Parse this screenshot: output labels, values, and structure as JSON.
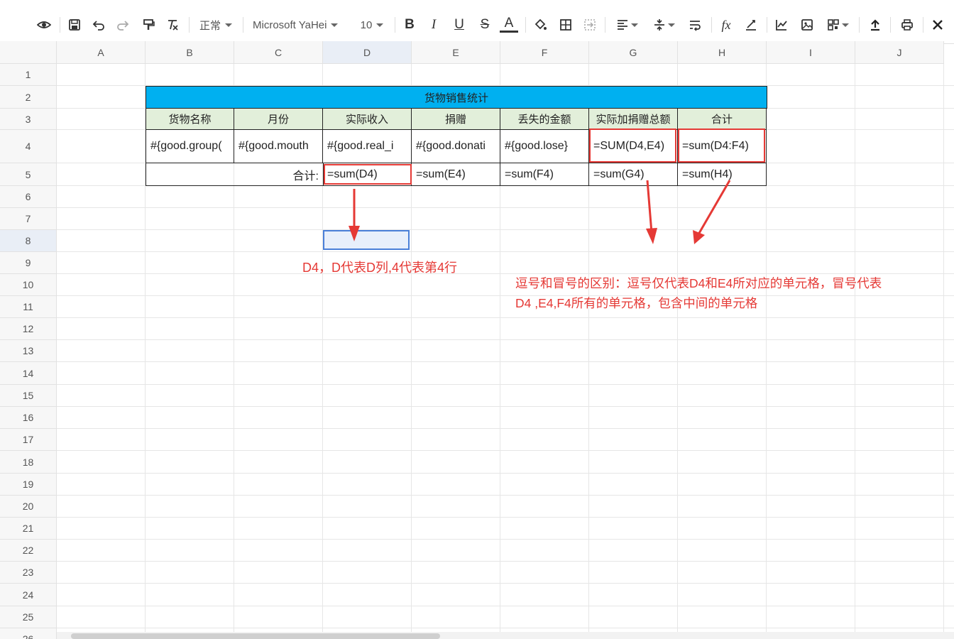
{
  "toolbar": {
    "style_label": "正常",
    "font_label": "Microsoft YaHei",
    "size_label": "10"
  },
  "columns": [
    "A",
    "B",
    "C",
    "D",
    "E",
    "F",
    "G",
    "H",
    "I",
    "J"
  ],
  "rows": [
    "1",
    "2",
    "3",
    "4",
    "5",
    "6",
    "7",
    "8",
    "9",
    "10",
    "11",
    "12",
    "13",
    "14",
    "15",
    "16",
    "17",
    "18",
    "19",
    "20",
    "21",
    "22",
    "23",
    "24",
    "25",
    "26"
  ],
  "table": {
    "title": "货物销售统计",
    "headers": [
      "货物名称",
      "月份",
      "实际收入",
      "捐赠",
      "丢失的金额",
      "实际加捐赠总额",
      "合计"
    ],
    "row4": [
      "#{good.group(",
      "#{good.mouth",
      "#{good.real_i",
      "#{good.donati",
      "#{good.lose}",
      "=SUM(D4,E4)",
      "=sum(D4:F4)"
    ],
    "row5_label": "合计:",
    "row5": [
      "=sum(D4)",
      "=sum(E4)",
      "=sum(F4)",
      "=sum(G4)",
      "=sum(H4)"
    ]
  },
  "annotations": {
    "d4_note": "D4，D代表D列,4代表第4行",
    "comma_colon_line1": "逗号和冒号的区别：逗号仅代表D4和E4所对应的单元格，冒号代表",
    "comma_colon_line2": "D4 ,E4,F4所有的单元格，包含中间的单元格"
  },
  "colors": {
    "title_fill": "#00b0f0",
    "header_fill": "#e2efda",
    "annotation_red": "#e53935",
    "selection_blue": "#4a7fd8"
  }
}
